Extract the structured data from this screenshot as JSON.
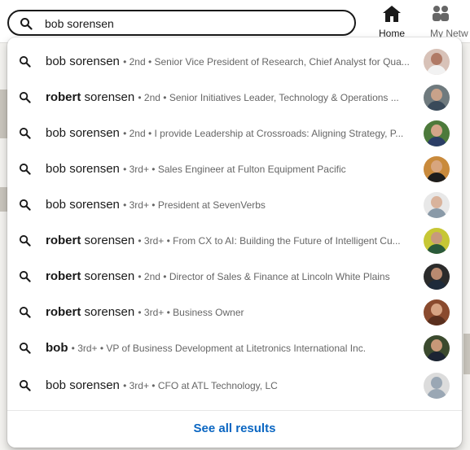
{
  "search": {
    "value": "bob sorensen"
  },
  "nav": [
    {
      "label": "Home",
      "icon": "home-icon"
    },
    {
      "label": "My Netw",
      "icon": "people-icon"
    }
  ],
  "results": [
    {
      "bold": "",
      "name": "bob sorensen",
      "meta": "• 2nd • Senior Vice President of Research, Chief Analyst for Qua...",
      "avatar": {
        "bg": "#d8c2b8",
        "skin": "#b07a66",
        "shirt": "#f2f2f2"
      }
    },
    {
      "bold": "robert",
      "name": " sorensen",
      "meta": "• 2nd • Senior Initiatives Leader, Technology & Operations ...",
      "avatar": {
        "bg": "#6f7a7e",
        "skin": "#c9a28a",
        "shirt": "#3a4a5a"
      }
    },
    {
      "bold": "",
      "name": "bob sorensen",
      "meta": "• 2nd • I provide Leadership at Crossroads: Aligning Strategy, P...",
      "avatar": {
        "bg": "#4d7a3b",
        "skin": "#d3a589",
        "shirt": "#2b3e66"
      }
    },
    {
      "bold": "",
      "name": "bob sorensen",
      "meta": "• 3rd+ • Sales Engineer at Fulton Equipment Pacific",
      "avatar": {
        "bg": "#c98a3c",
        "skin": "#d8a57e",
        "shirt": "#1d1d1d"
      }
    },
    {
      "bold": "",
      "name": "bob sorensen",
      "meta": "• 3rd+ • President at SevenVerbs",
      "avatar": {
        "bg": "#e8e8e8",
        "skin": "#d9b39c",
        "shirt": "#8a9aa8"
      }
    },
    {
      "bold": "robert",
      "name": " sorensen",
      "meta": "• 3rd+ • From CX to AI: Building the Future of Intelligent Cu...",
      "avatar": {
        "bg": "#c7c735",
        "skin": "#c79a7c",
        "shirt": "#2a5a3a"
      }
    },
    {
      "bold": "robert",
      "name": " sorensen",
      "meta": "• 2nd • Director of Sales & Finance at Lincoln White Plains",
      "avatar": {
        "bg": "#2b2b2b",
        "skin": "#b98a70",
        "shirt": "#1e2a3a"
      }
    },
    {
      "bold": "robert",
      "name": " sorensen",
      "meta": "• 3rd+ • Business Owner",
      "avatar": {
        "bg": "#8a4a2e",
        "skin": "#d6a383",
        "shirt": "#5a2f1e"
      }
    },
    {
      "bold": "bob",
      "name": "",
      "meta": "• 3rd+ • VP of Business Development at Litetronics International Inc.",
      "avatar": {
        "bg": "#3b4a2e",
        "skin": "#c89878",
        "shirt": "#1c2433"
      }
    },
    {
      "bold": "",
      "name": "bob sorensen",
      "meta": "• 3rd+ • CFO at ATL Technology, LC",
      "avatar": {
        "bg": "#dcdcdc",
        "skin": "#9aa7b4",
        "shirt": "#9aa7b4"
      }
    }
  ],
  "see_all": "See all results"
}
